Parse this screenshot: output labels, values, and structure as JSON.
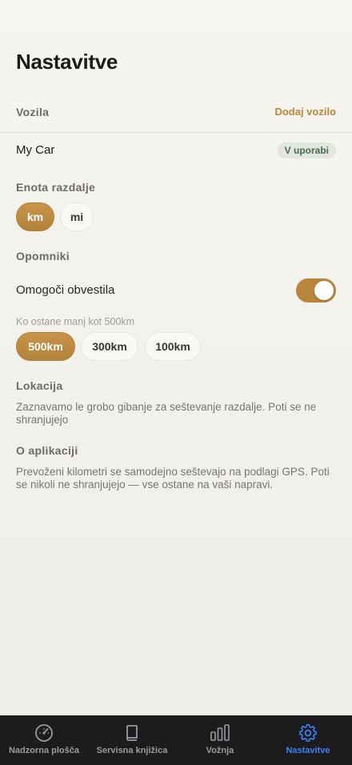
{
  "page": {
    "title": "Nastavitve"
  },
  "vehicles": {
    "section_label": "Vozila",
    "add_label": "Dodaj vozilo",
    "items": [
      {
        "name": "My Car",
        "badge": "V uporabi"
      }
    ]
  },
  "distance_unit": {
    "section_label": "Enota razdalje",
    "options": [
      "km",
      "mi"
    ],
    "selected": "km"
  },
  "reminders": {
    "section_label": "Opomniki",
    "enable_label": "Omogoči obvestila",
    "enabled": true,
    "threshold_hint": "Ko ostane manj kot 500km",
    "options": [
      "500km",
      "300km",
      "100km"
    ],
    "selected": "500km"
  },
  "location": {
    "section_label": "Lokacija",
    "text": "Zaznavamo le grobo gibanje za seštevanje razdalje. Poti se ne shranjujejo"
  },
  "about": {
    "section_label": "O aplikaciji",
    "text": "Prevoženi kilometri se samodejno seštevajo na podlagi GPS. Poti se nikoli ne shranjujejo — vse ostane na vaši napravi."
  },
  "tabbar": {
    "tabs": [
      {
        "label": "Nadzorna plošča",
        "icon": "gauge-icon"
      },
      {
        "label": "Servisna knjižica",
        "icon": "book-icon"
      },
      {
        "label": "Vožnja",
        "icon": "bar-chart-icon"
      },
      {
        "label": "Nastavitve",
        "icon": "gear-icon",
        "active": true
      }
    ],
    "active_color": "#3b82f6"
  },
  "colors": {
    "accent": "#b8853d",
    "badge_bg": "#dfe7df",
    "badge_text": "#4f6b55"
  }
}
